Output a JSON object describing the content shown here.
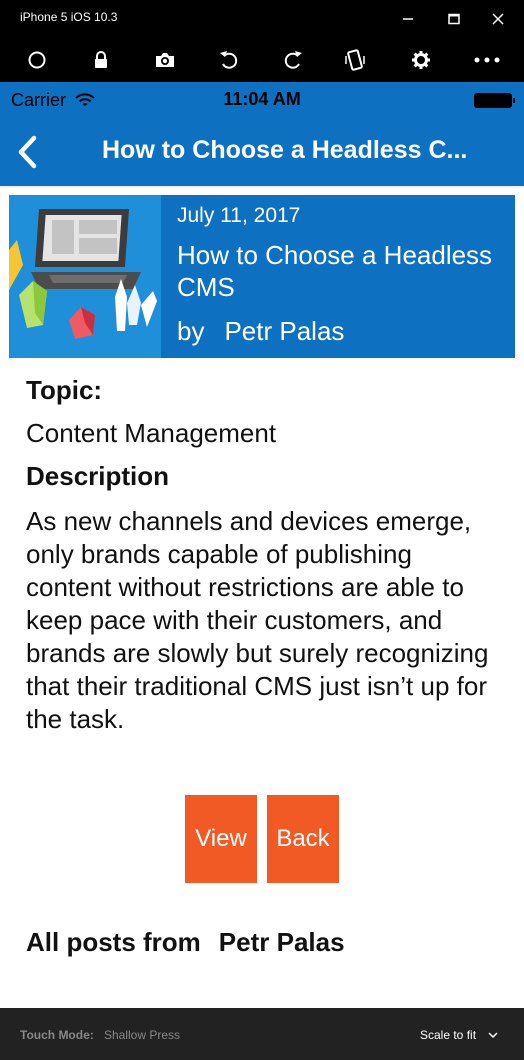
{
  "window": {
    "title": "iPhone 5 iOS 10.3"
  },
  "toolbar": {
    "icons": [
      "home-icon",
      "lock-icon",
      "camera-icon",
      "rotate-left-icon",
      "rotate-right-icon",
      "shake-icon",
      "gear-icon",
      "more-icon"
    ]
  },
  "statusbar": {
    "carrier": "Carrier",
    "time": "11:04 AM"
  },
  "navbar": {
    "title": "How to Choose a Headless C..."
  },
  "post": {
    "date": "July 11, 2017",
    "title": "How to Choose a Headless CMS",
    "by": "by",
    "author": "Petr Palas"
  },
  "detail": {
    "topic_label": "Topic:",
    "topic_value": "Content Management",
    "description_label": "Description",
    "description_value": "As new channels and devices emerge, only brands capable of publishing content without restrictions are able to keep pace with their customers, and brands are slowly but surely recognizing that their traditional CMS just isn’t up for the task."
  },
  "buttons": {
    "view": "View",
    "back": "Back"
  },
  "all_posts": {
    "prefix": "All posts from",
    "author": "Petr Palas"
  },
  "bottombar": {
    "touch_mode_label": "Touch Mode:",
    "touch_mode_value": "Shallow Press",
    "scale": "Scale to fit"
  },
  "colors": {
    "brand_blue": "#0d70c0",
    "button_orange": "#f15a24"
  }
}
